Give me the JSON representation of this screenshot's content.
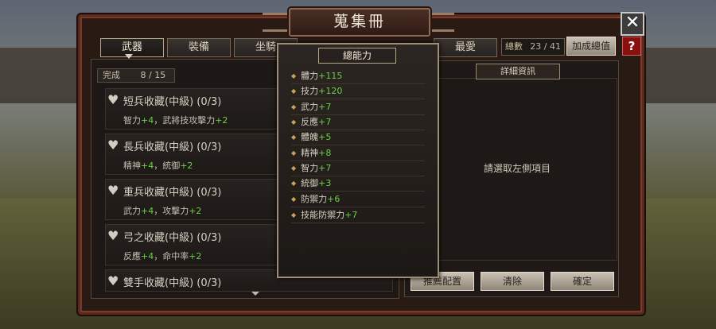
{
  "window": {
    "title": "蒐集冊"
  },
  "tabs": [
    {
      "label": "武器"
    },
    {
      "label": "裝備"
    },
    {
      "label": "坐騎"
    },
    {
      "label": "最愛"
    }
  ],
  "total": {
    "label": "總數",
    "value": "23 / 41"
  },
  "buttons": {
    "add_total": "加成總值",
    "recommend": "推薦配置",
    "clear": "清除",
    "confirm": "確定",
    "close": "✕",
    "help": "?"
  },
  "progress": {
    "label": "完成",
    "value": "8 / 15"
  },
  "collections": [
    {
      "name": "短兵收藏(中級) (0/3)",
      "b1": "智力",
      "v1": "+4",
      "sep": "，",
      "b2": "武將技攻擊力",
      "v2": "+2"
    },
    {
      "name": "長兵收藏(中級) (0/3)",
      "b1": "精神",
      "v1": "+4",
      "sep": "，",
      "b2": "統御",
      "v2": "+2"
    },
    {
      "name": "重兵收藏(中級) (0/3)",
      "b1": "武力",
      "v1": "+4",
      "sep": "，",
      "b2": "攻擊力",
      "v2": "+2"
    },
    {
      "name": "弓之收藏(中級) (0/3)",
      "b1": "反應",
      "v1": "+4",
      "sep": "，",
      "b2": "命中率",
      "v2": "+2"
    },
    {
      "name": "雙手收藏(中級) (0/3)"
    }
  ],
  "detail": {
    "title": "詳細資訊",
    "hint": "請選取左側項目"
  },
  "popup": {
    "title": "總能力",
    "stats": [
      {
        "name": "體力",
        "value": "+115"
      },
      {
        "name": "技力",
        "value": "+120"
      },
      {
        "name": "武力",
        "value": "+7"
      },
      {
        "name": "反應",
        "value": "+7"
      },
      {
        "name": "體魄",
        "value": "+5"
      },
      {
        "name": "精神",
        "value": "+8"
      },
      {
        "name": "智力",
        "value": "+7"
      },
      {
        "name": "統御",
        "value": "+3"
      },
      {
        "name": "防禦力",
        "value": "+6"
      },
      {
        "name": "技能防禦力",
        "value": "+7"
      }
    ]
  },
  "colors": {
    "bonus_green": "#6ccf4a",
    "frame": "#5a2a1e",
    "help_red": "#8a1010"
  },
  "icons": {
    "collection_item": "heart-icon",
    "popup_bullet": "diamond-icon"
  }
}
